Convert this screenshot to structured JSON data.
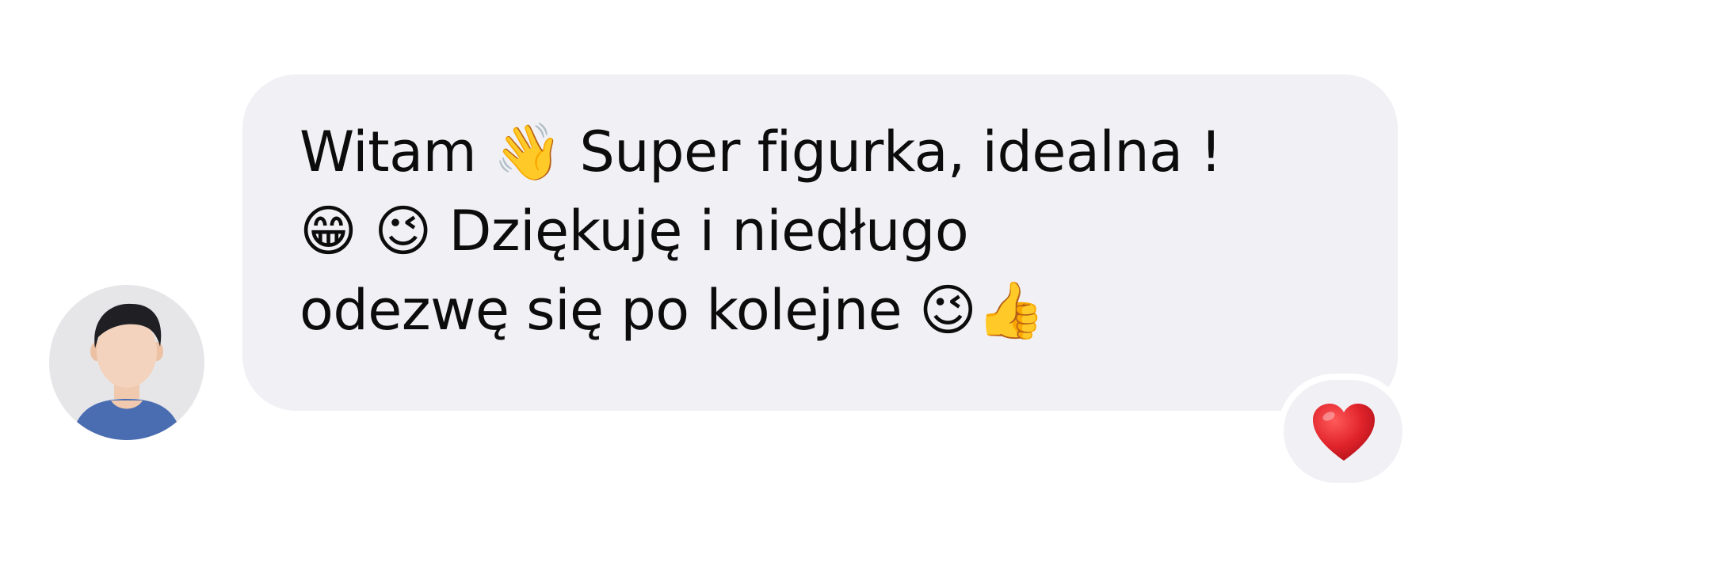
{
  "message": {
    "lines": [
      "Witam 👋 Super figurka, idealna !",
      "😁 😉 Dziękuję i niedługo",
      "odezwę się po kolejne 😉👍"
    ]
  },
  "reaction": {
    "emoji": "heart-icon",
    "color": "#e0232b"
  },
  "avatar": {
    "icon": "person-avatar-icon"
  },
  "colors": {
    "bubble": "#f0f0f5",
    "text": "#0c0c0c",
    "avatar_bg": "#e6e6e9",
    "shirt": "#4a6cb0"
  }
}
